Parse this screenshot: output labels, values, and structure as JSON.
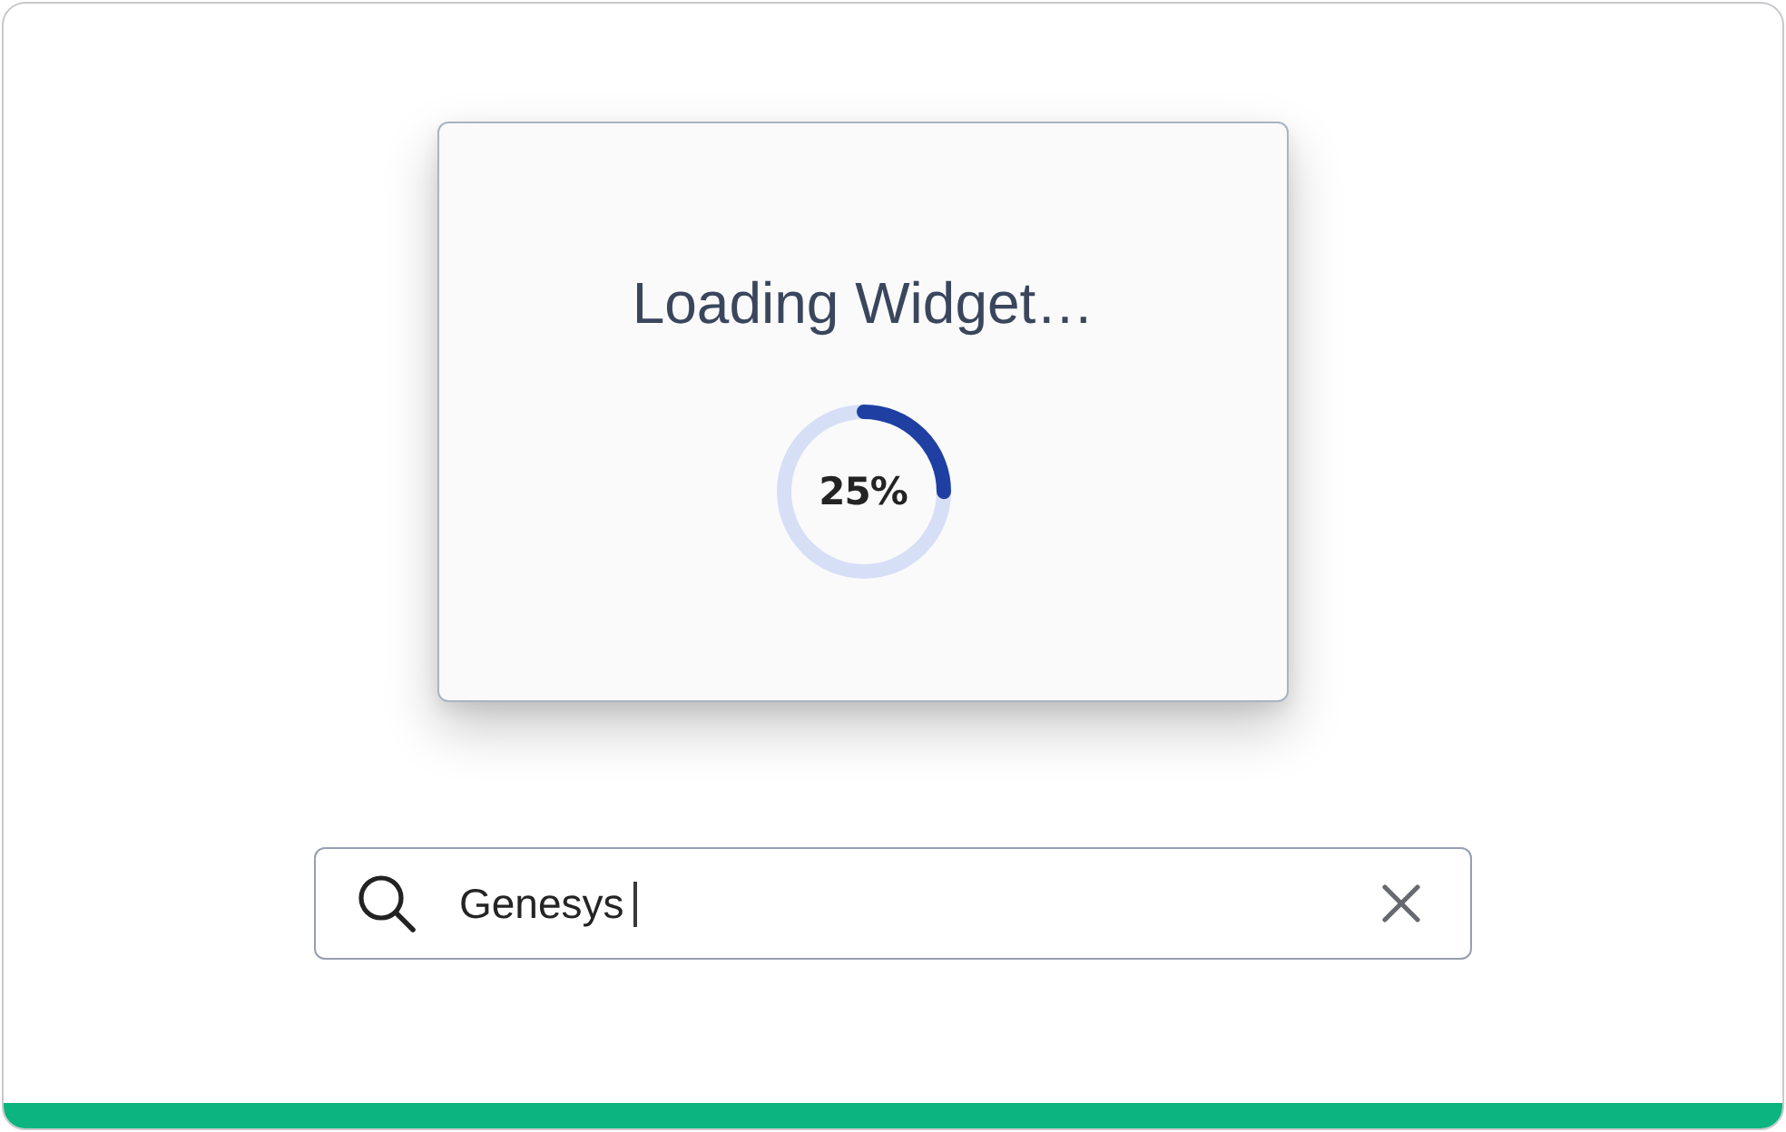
{
  "loading_card": {
    "title": "Loading Widget…",
    "progress": {
      "level": 0.25,
      "reading": "25%"
    }
  },
  "search": {
    "value": "Genesys",
    "focused": true
  }
}
